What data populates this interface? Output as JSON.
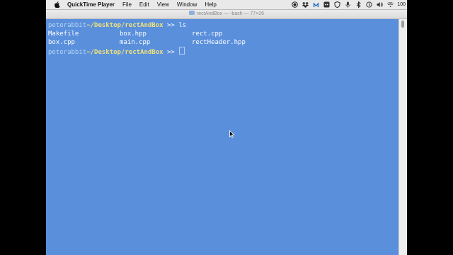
{
  "menubar": {
    "app_name": "QuickTime Player",
    "menus": [
      "File",
      "Edit",
      "View",
      "Window",
      "Help"
    ],
    "battery_text": "100"
  },
  "window": {
    "title": "rectAndBox — -bash — 77×26"
  },
  "terminal": {
    "prompt_user": "peterabbit",
    "prompt_path": "~/Desktop/rectAndBox",
    "prompt_symbol": ">>",
    "command": "ls",
    "files": [
      [
        "Makefile",
        "box.hpp",
        "rect.cpp"
      ],
      [
        "box.cpp",
        "main.cpp",
        "rectHeader.hpp"
      ]
    ]
  },
  "colors": {
    "terminal_bg": "#5a8fdc",
    "prompt_path": "#f0e27a"
  }
}
